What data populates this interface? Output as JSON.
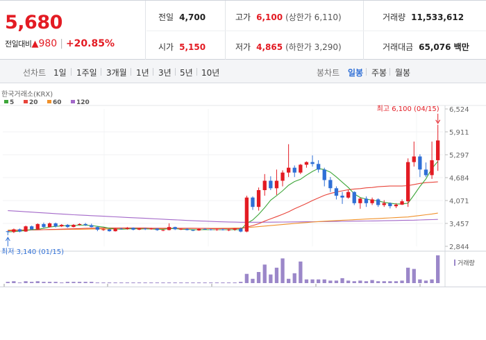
{
  "quote": {
    "price": "5,680",
    "change_label": "전일대비",
    "change_arrow": "▲",
    "change_value": "980",
    "change_pct": "+20.85%",
    "prev_close_label": "전일",
    "prev_close": "4,700",
    "open_label": "시가",
    "open": "5,150",
    "high_label": "고가",
    "high": "6,100",
    "upper_limit": "(상한가 6,110)",
    "low_label": "저가",
    "low": "4,865",
    "lower_limit": "(하한가 3,290)",
    "volume_label": "거래량",
    "volume": "11,533,612",
    "amount_label": "거래대금",
    "amount": "65,076 백만"
  },
  "tabs": {
    "line_title": "선차트",
    "line_items": [
      "1일",
      "1주일",
      "3개월",
      "1년",
      "3년",
      "5년",
      "10년"
    ],
    "candle_title": "봉차트",
    "candle_items": [
      "일봉",
      "주봉",
      "월봉"
    ],
    "candle_active": 0
  },
  "colors": {
    "up": "#e31b23",
    "down": "#2f6fd6",
    "accent": "#2f6fd6"
  },
  "chart_data": {
    "type": "candlestick",
    "source_label": "한국거래소(KRX)",
    "legend": [
      {
        "name": "5",
        "color": "#3ea63a"
      },
      {
        "name": "20",
        "color": "#e8443a"
      },
      {
        "name": "60",
        "color": "#f0902a"
      },
      {
        "name": "120",
        "color": "#a368c9"
      }
    ],
    "y_ticks": [
      "6,524",
      "5,911",
      "5,297",
      "4,684",
      "4,071",
      "3,457",
      "2,844"
    ],
    "ylim": [
      2844,
      6524
    ],
    "high_label": "최고 6,100 (04/15)",
    "low_label": "최저 3,140 (01/15)",
    "volume_label": "거래량",
    "candles": [
      [
        3250,
        3260,
        3140,
        3230
      ],
      [
        3230,
        3320,
        3200,
        3300
      ],
      [
        3300,
        3320,
        3220,
        3240
      ],
      [
        3240,
        3400,
        3230,
        3380
      ],
      [
        3380,
        3400,
        3280,
        3300
      ],
      [
        3300,
        3460,
        3290,
        3440
      ],
      [
        3440,
        3480,
        3340,
        3360
      ],
      [
        3360,
        3480,
        3350,
        3460
      ],
      [
        3460,
        3480,
        3350,
        3380
      ],
      [
        3380,
        3440,
        3360,
        3420
      ],
      [
        3420,
        3440,
        3340,
        3360
      ],
      [
        3360,
        3440,
        3350,
        3420
      ],
      [
        3420,
        3460,
        3400,
        3440
      ],
      [
        3440,
        3470,
        3390,
        3410
      ],
      [
        3410,
        3450,
        3350,
        3360
      ],
      [
        3360,
        3380,
        3250,
        3290
      ],
      [
        3290,
        3320,
        3260,
        3300
      ],
      [
        3300,
        3310,
        3240,
        3250
      ],
      [
        3250,
        3330,
        3240,
        3320
      ],
      [
        3320,
        3340,
        3300,
        3310
      ],
      [
        3310,
        3360,
        3290,
        3340
      ],
      [
        3340,
        3350,
        3270,
        3290
      ],
      [
        3290,
        3330,
        3280,
        3320
      ],
      [
        3320,
        3340,
        3280,
        3300
      ],
      [
        3300,
        3340,
        3290,
        3320
      ],
      [
        3320,
        3330,
        3260,
        3280
      ],
      [
        3280,
        3290,
        3250,
        3280
      ],
      [
        3280,
        3460,
        3270,
        3360
      ],
      [
        3360,
        3370,
        3280,
        3300
      ],
      [
        3300,
        3320,
        3280,
        3310
      ],
      [
        3310,
        3330,
        3270,
        3280
      ],
      [
        3280,
        3300,
        3250,
        3270
      ],
      [
        3270,
        3320,
        3260,
        3310
      ],
      [
        3310,
        3330,
        3290,
        3300
      ],
      [
        3300,
        3310,
        3270,
        3290
      ],
      [
        3290,
        3320,
        3260,
        3300
      ],
      [
        3300,
        3320,
        3270,
        3280
      ],
      [
        3280,
        3310,
        3250,
        3290
      ],
      [
        3290,
        3330,
        3260,
        3320
      ],
      [
        3320,
        3350,
        3220,
        3240
      ],
      [
        3240,
        4200,
        3220,
        4150
      ],
      [
        4150,
        4180,
        3820,
        3900
      ],
      [
        3900,
        4420,
        3800,
        4350
      ],
      [
        4350,
        4780,
        4200,
        4600
      ],
      [
        4600,
        4720,
        4350,
        4400
      ],
      [
        4400,
        4900,
        4220,
        4600
      ],
      [
        4600,
        4880,
        4450,
        4820
      ],
      [
        4820,
        5580,
        4700,
        4950
      ],
      [
        4950,
        5010,
        4700,
        4820
      ],
      [
        4820,
        5050,
        4780,
        5030
      ],
      [
        5030,
        5120,
        4950,
        5100
      ],
      [
        5100,
        5280,
        4980,
        5050
      ],
      [
        5050,
        5150,
        4820,
        4900
      ],
      [
        4900,
        4950,
        4450,
        4620
      ],
      [
        4620,
        4700,
        4300,
        4400
      ],
      [
        4400,
        4450,
        4100,
        4200
      ],
      [
        4200,
        4300,
        3980,
        4150
      ],
      [
        4150,
        4350,
        4120,
        4300
      ],
      [
        4300,
        4320,
        3950,
        4000
      ],
      [
        4000,
        4150,
        3850,
        4120
      ],
      [
        4120,
        4180,
        3900,
        4000
      ],
      [
        4000,
        4150,
        3950,
        4100
      ],
      [
        4100,
        4130,
        3900,
        3950
      ],
      [
        3950,
        4080,
        3900,
        4000
      ],
      [
        4000,
        4020,
        3860,
        3920
      ],
      [
        3920,
        4000,
        3870,
        3960
      ],
      [
        3960,
        4100,
        3950,
        4050
      ],
      [
        4050,
        5200,
        3900,
        5100
      ],
      [
        5100,
        5650,
        4980,
        5250
      ],
      [
        5250,
        5310,
        4700,
        4900
      ],
      [
        4900,
        5090,
        4700,
        4750
      ],
      [
        4750,
        5650,
        4650,
        5150
      ],
      [
        5150,
        6100,
        4865,
        5680
      ]
    ],
    "ma5": [
      3230,
      3240,
      3250,
      3270,
      3290,
      3300,
      3330,
      3360,
      3380,
      3390,
      3400,
      3400,
      3410,
      3410,
      3400,
      3380,
      3360,
      3330,
      3310,
      3300,
      3310,
      3320,
      3310,
      3310,
      3310,
      3300,
      3300,
      3320,
      3320,
      3300,
      3300,
      3290,
      3290,
      3290,
      3290,
      3290,
      3290,
      3290,
      3290,
      3290,
      3460,
      3550,
      3700,
      3880,
      4080,
      4200,
      4330,
      4480,
      4580,
      4640,
      4750,
      4850,
      4930,
      4900,
      4830,
      4700,
      4560,
      4420,
      4250,
      4150,
      4110,
      4080,
      4060,
      4020,
      4000,
      3980,
      3980,
      4000,
      4220,
      4450,
      4650,
      4930,
      5120
    ],
    "ma20": [
      3260,
      3265,
      3270,
      3275,
      3280,
      3285,
      3290,
      3295,
      3300,
      3305,
      3310,
      3315,
      3320,
      3325,
      3330,
      3335,
      3335,
      3335,
      3335,
      3335,
      3335,
      3335,
      3335,
      3335,
      3330,
      3330,
      3330,
      3330,
      3330,
      3330,
      3330,
      3330,
      3325,
      3325,
      3320,
      3320,
      3320,
      3320,
      3320,
      3320,
      3360,
      3400,
      3450,
      3520,
      3580,
      3640,
      3700,
      3770,
      3850,
      3920,
      3990,
      4070,
      4140,
      4210,
      4260,
      4300,
      4330,
      4360,
      4380,
      4390,
      4410,
      4420,
      4440,
      4450,
      4460,
      4460,
      4460,
      4470,
      4500,
      4530,
      4550,
      4560,
      4570
    ],
    "ma60": [
      3280,
      3280,
      3282,
      3284,
      3286,
      3288,
      3290,
      3292,
      3294,
      3296,
      3298,
      3300,
      3302,
      3304,
      3306,
      3308,
      3310,
      3310,
      3312,
      3312,
      3314,
      3314,
      3316,
      3316,
      3318,
      3318,
      3320,
      3320,
      3322,
      3322,
      3324,
      3324,
      3326,
      3326,
      3328,
      3328,
      3330,
      3330,
      3332,
      3332,
      3345,
      3358,
      3372,
      3386,
      3400,
      3414,
      3428,
      3442,
      3456,
      3470,
      3482,
      3494,
      3506,
      3516,
      3526,
      3534,
      3542,
      3550,
      3558,
      3566,
      3574,
      3582,
      3590,
      3598,
      3606,
      3614,
      3622,
      3630,
      3650,
      3670,
      3690,
      3710,
      3735
    ],
    "ma120": [
      3800,
      3790,
      3780,
      3770,
      3760,
      3750,
      3740,
      3730,
      3720,
      3710,
      3700,
      3690,
      3682,
      3674,
      3666,
      3658,
      3650,
      3642,
      3634,
      3626,
      3618,
      3610,
      3602,
      3594,
      3586,
      3578,
      3570,
      3562,
      3554,
      3546,
      3538,
      3530,
      3524,
      3518,
      3512,
      3506,
      3500,
      3496,
      3492,
      3488,
      3488,
      3488,
      3489,
      3490,
      3491,
      3492,
      3494,
      3496,
      3498,
      3500,
      3502,
      3504,
      3506,
      3508,
      3510,
      3512,
      3514,
      3516,
      3518,
      3520,
      3522,
      3524,
      3527,
      3530,
      3533,
      3536,
      3539,
      3542,
      3545,
      3550,
      3555,
      3560,
      3566
    ],
    "volumes": [
      2,
      3,
      1,
      3,
      2,
      3,
      2,
      2,
      2,
      1,
      2,
      2,
      2,
      2,
      2,
      1,
      1,
      1,
      1,
      1,
      1,
      1,
      1,
      1,
      1,
      1,
      1,
      1,
      1,
      1,
      1,
      1,
      1,
      1,
      1,
      1,
      1,
      1,
      1,
      2,
      15,
      7,
      18,
      30,
      14,
      25,
      40,
      7,
      16,
      35,
      6,
      6,
      6,
      6,
      4,
      4,
      8,
      4,
      3,
      4,
      3,
      5,
      3,
      3,
      3,
      3,
      4,
      25,
      23,
      6,
      4,
      6,
      45
    ]
  }
}
